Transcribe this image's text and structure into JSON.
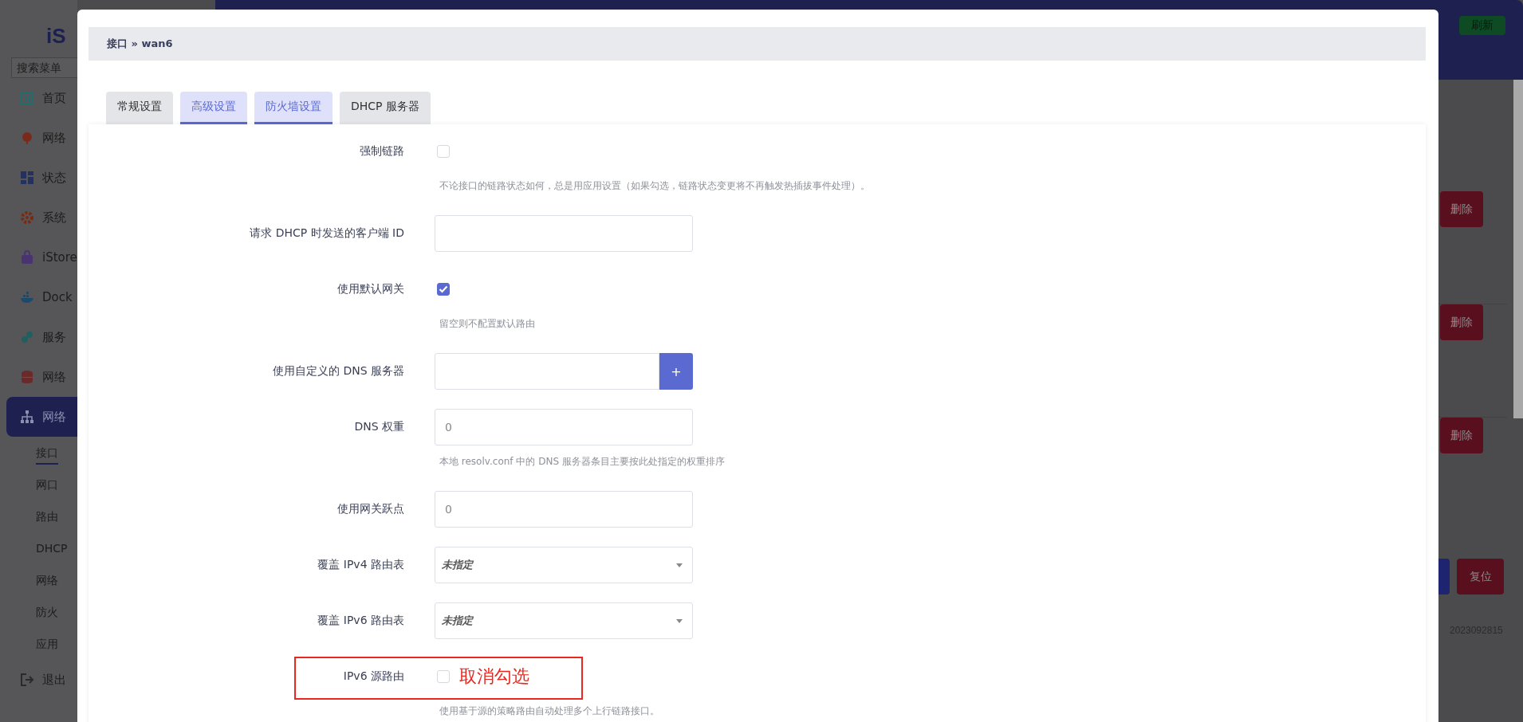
{
  "sidebar": {
    "logo": "iS",
    "search": {
      "placeholder": "搜索菜单"
    },
    "items": [
      {
        "label": "首页",
        "selected": false
      },
      {
        "label": "网络",
        "selected": false
      },
      {
        "label": "状态",
        "selected": false
      },
      {
        "label": "系统",
        "selected": false
      },
      {
        "label": "iStore",
        "selected": false
      },
      {
        "label": "Dock",
        "selected": false
      },
      {
        "label": "服务",
        "selected": false
      },
      {
        "label": "网络",
        "selected": false
      },
      {
        "label": "网络",
        "selected": true,
        "children": [
          {
            "label": "接口",
            "selected": true
          },
          {
            "label": "网口",
            "selected": false
          },
          {
            "label": "路由",
            "selected": false
          },
          {
            "label": "DHCP",
            "selected": false
          },
          {
            "label": "网络",
            "selected": false
          },
          {
            "label": "防火",
            "selected": false
          },
          {
            "label": "应用",
            "selected": false
          }
        ]
      }
    ],
    "logout": "退出"
  },
  "header": {
    "refresh_button": "刷新"
  },
  "background": {
    "delete_buttons": [
      "删除",
      "删除",
      "删除"
    ],
    "reset_button": "复位",
    "version": "2023092815"
  },
  "modal": {
    "breadcrumb": "接口 » wan6",
    "tabs": [
      {
        "label": "常规设置",
        "selected": false
      },
      {
        "label": "高级设置",
        "selected": true
      },
      {
        "label": "防火墙设置",
        "selected": true
      },
      {
        "label": "DHCP 服务器",
        "selected": false
      }
    ],
    "fields": [
      {
        "kind": "checkbox",
        "label": "强制链路",
        "checked": false,
        "hint": "不论接口的链路状态如何，总是用应用设置（如果勾选，链路状态变更将不再触发热插拔事件处理）。"
      },
      {
        "kind": "text",
        "label": "请求 DHCP 时发送的客户端 ID"
      },
      {
        "kind": "checkbox",
        "label": "使用默认网关",
        "checked": true,
        "hint": "留空则不配置默认路由"
      },
      {
        "kind": "dynlist",
        "label": "使用自定义的 DNS 服务器",
        "button": "+"
      },
      {
        "kind": "text",
        "label": "DNS 权重",
        "placeholder": "0",
        "hint": "本地 resolv.conf 中的 DNS 服务器条目主要按此处指定的权重排序"
      },
      {
        "kind": "text",
        "label": "使用网关跃点",
        "placeholder": "0"
      },
      {
        "kind": "select",
        "label": "覆盖 IPv4 路由表",
        "value": "未指定"
      },
      {
        "kind": "select",
        "label": "覆盖 IPv6 路由表",
        "value": "未指定"
      },
      {
        "kind": "checkbox",
        "label": "IPv6 源路由",
        "checked": false,
        "annotation": "取消勾选",
        "hint": "使用基于源的策略路由自动处理多个上行链路接口。"
      }
    ]
  }
}
